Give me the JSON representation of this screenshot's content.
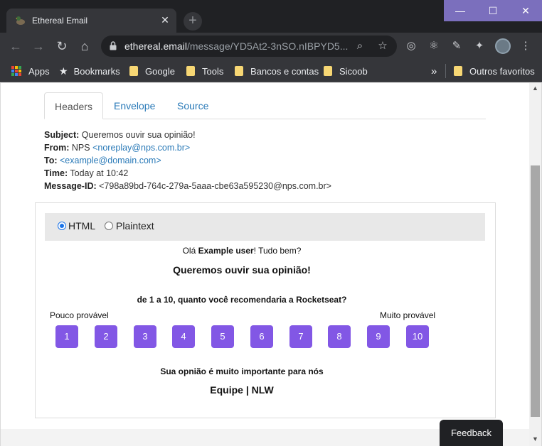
{
  "browser": {
    "tab_title": "Ethereal Email",
    "tab_close": "✕",
    "new_tab": "+",
    "window_controls": {
      "minimize": "—",
      "maximize": "☐",
      "close": "✕"
    },
    "url_host": "ethereal.email",
    "url_path": "/message/YD5At2-3nSO.nIBPYD5...",
    "bookmarks": [
      {
        "label": "Apps",
        "icon": "apps-grid-icon"
      },
      {
        "label": "Bookmarks",
        "icon": "star-icon"
      },
      {
        "label": "Google",
        "icon": "folder-icon"
      },
      {
        "label": "Tools",
        "icon": "folder-icon"
      },
      {
        "label": "Bancos e contas",
        "icon": "folder-icon"
      },
      {
        "label": "Sicoob",
        "icon": "folder-icon"
      }
    ],
    "bookmarks_overflow": "»",
    "other_bookmarks": "Outros favoritos"
  },
  "tabs": [
    "Headers",
    "Envelope",
    "Source"
  ],
  "headers": {
    "subject_label": "Subject:",
    "subject": "Queremos ouvir sua opinião!",
    "from_label": "From:",
    "from_name": "NPS",
    "from_email": "<noreplay@nps.com.br>",
    "to_label": "To:",
    "to_email": "<example@domain.com>",
    "time_label": "Time:",
    "time": "Today at 10:42",
    "message_id_label": "Message-ID:",
    "message_id": "<798a89bd-764c-279a-5aaa-cbe63a595230@nps.com.br>"
  },
  "view_options": {
    "html": "HTML",
    "plaintext": "Plaintext",
    "selected": "HTML"
  },
  "email": {
    "greeting_prefix": "Olá",
    "greeting_name": "Example user",
    "greeting_suffix": "! Tudo bem?",
    "heading": "Queremos ouvir sua opinião!",
    "question_prefix": "de",
    "question_range_start": "1",
    "question_middle": "a",
    "question_range_end": "10",
    "question_suffix": ", quanto você recomendaria a Rocketseat?",
    "low_label": "Pouco provável",
    "high_label": "Muito provável",
    "scores": [
      "1",
      "2",
      "3",
      "4",
      "5",
      "6",
      "7",
      "8",
      "9",
      "10"
    ],
    "footer_note": "Sua opnião é muito importante para nós",
    "signature": "Equipe | NLW"
  },
  "feedback_button": "Feedback",
  "colors": {
    "score_button": "#8257e5",
    "link": "#2a7ab8",
    "window_controls": "#7b6fbd"
  }
}
